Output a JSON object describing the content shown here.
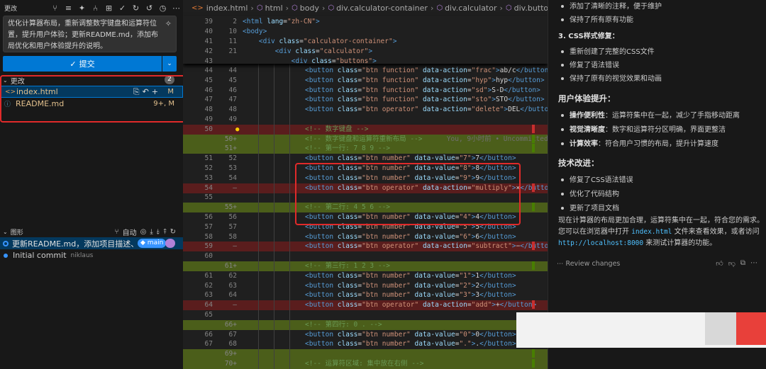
{
  "scm": {
    "title": "更改",
    "commit_message": "优化计算器布局，重新调整数字键盘和运算符位置，提升用户体验；更新README.md，添加布局优化和用户体验提升的说明。",
    "commit_label": "提交",
    "changes_label": "更改",
    "changes_count": "2",
    "files": [
      {
        "name": "index.html",
        "status": "M"
      },
      {
        "name": "README.md",
        "status": "9+, M"
      }
    ],
    "graph_label": "图形",
    "graph_auto": "自动",
    "commits": [
      {
        "message": "更新README.md，添加项目描述、功...",
        "branch": "main"
      },
      {
        "message": "Initial commit",
        "author": "niklaus"
      }
    ]
  },
  "editor": {
    "breadcrumb": [
      "index.html",
      "html",
      "body",
      "div.calculator-container",
      "div.calculator",
      "div.buttons"
    ],
    "sticky": [
      {
        "ln1": "39",
        "ln2": "2",
        "html": "<html lang=\"zh-CN\">"
      },
      {
        "ln1": "40",
        "ln2": "10",
        "html": "<body>"
      },
      {
        "ln1": "41",
        "ln2": "11",
        "html": "    <div class=\"calculator-container\">"
      },
      {
        "ln1": "42",
        "ln2": "21",
        "html": "        <div class=\"calculator\">"
      },
      {
        "ln1": "43",
        "ln2": "",
        "html": "            <div class=\"buttons\">"
      }
    ],
    "lines": [
      {
        "ln1": "44",
        "ln2": "44",
        "kind": "",
        "code": "<button class=\"btn function\" data-action=\"frac\">ab/c</button>"
      },
      {
        "ln1": "45",
        "ln2": "45",
        "kind": "",
        "code": "<button class=\"btn function\" data-action=\"hyp\">hyp</button>"
      },
      {
        "ln1": "46",
        "ln2": "46",
        "kind": "",
        "code": "<button class=\"btn function\" data-action=\"sd\">S-D</button>"
      },
      {
        "ln1": "47",
        "ln2": "47",
        "kind": "",
        "code": "<button class=\"btn function\" data-action=\"sto\">STO</button>"
      },
      {
        "ln1": "48",
        "ln2": "48",
        "kind": "",
        "code": "<button class=\"btn operator\" data-action=\"delete\">DEL</button>"
      },
      {
        "ln1": "49",
        "ln2": "49",
        "kind": "",
        "code": ""
      },
      {
        "ln1": "50",
        "ln2": "",
        "kind": "del",
        "code": "<!-- 数字键盘 -->"
      },
      {
        "ln1": "",
        "ln2": "50+",
        "kind": "add",
        "code": "<!-- 数字键盘和运算符重新布局 -->      You, 9小时前 • Uncommitted"
      },
      {
        "ln1": "",
        "ln2": "51+",
        "kind": "add",
        "code": "<!-- 第一行: 7 8 9 -->"
      },
      {
        "ln1": "51",
        "ln2": "52",
        "kind": "",
        "code": "<button class=\"btn number\" data-value=\"7\">7</button>"
      },
      {
        "ln1": "52",
        "ln2": "53",
        "kind": "",
        "code": "<button class=\"btn number\" data-value=\"8\">8</button>"
      },
      {
        "ln1": "53",
        "ln2": "54",
        "kind": "",
        "code": "<button class=\"btn number\" data-value=\"9\">9</button>"
      },
      {
        "ln1": "54",
        "ln2": "—",
        "kind": "del",
        "code": "<button class=\"btn operator\" data-action=\"multiply\">×</button>"
      },
      {
        "ln1": "55",
        "ln2": "",
        "kind": "",
        "code": ""
      },
      {
        "ln1": "",
        "ln2": "55+",
        "kind": "add",
        "code": "<!-- 第二行: 4 5 6 -->"
      },
      {
        "ln1": "56",
        "ln2": "56",
        "kind": "",
        "code": "<button class=\"btn number\" data-value=\"4\">4</button>"
      },
      {
        "ln1": "57",
        "ln2": "57",
        "kind": "",
        "code": "<button class=\"btn number\" data-value=\"5\">5</button>"
      },
      {
        "ln1": "58",
        "ln2": "58",
        "kind": "",
        "code": "<button class=\"btn number\" data-value=\"6\">6</button>"
      },
      {
        "ln1": "59",
        "ln2": "—",
        "kind": "del",
        "code": "<button class=\"btn operator\" data-action=\"subtract\">−</button>"
      },
      {
        "ln1": "60",
        "ln2": "",
        "kind": "",
        "code": ""
      },
      {
        "ln1": "",
        "ln2": "61+",
        "kind": "add",
        "code": "<!-- 第三行: 1 2 3 -->"
      },
      {
        "ln1": "61",
        "ln2": "62",
        "kind": "",
        "code": "<button class=\"btn number\" data-value=\"1\">1</button>"
      },
      {
        "ln1": "62",
        "ln2": "63",
        "kind": "",
        "code": "<button class=\"btn number\" data-value=\"2\">2</button>"
      },
      {
        "ln1": "63",
        "ln2": "64",
        "kind": "",
        "code": "<button class=\"btn number\" data-value=\"3\">3</button>"
      },
      {
        "ln1": "64",
        "ln2": "—",
        "kind": "del",
        "code": "<button class=\"btn operator\" data-action=\"add\">+</button>"
      },
      {
        "ln1": "65",
        "ln2": "",
        "kind": "",
        "code": ""
      },
      {
        "ln1": "",
        "ln2": "66+",
        "kind": "add",
        "code": "<!-- 第四行: 0 . -->"
      },
      {
        "ln1": "66",
        "ln2": "67",
        "kind": "",
        "code": "<button class=\"btn number\" data-value=\"0\">0</button>"
      },
      {
        "ln1": "67",
        "ln2": "68",
        "kind": "",
        "code": "<button class=\"btn number\" data-value=\".\">.</button>"
      },
      {
        "ln1": "",
        "ln2": "69+",
        "kind": "add",
        "code": ""
      },
      {
        "ln1": "",
        "ln2": "70+",
        "kind": "add",
        "code": "<!-- 运算符区域: 集中放在右侧 -->"
      }
    ]
  },
  "chat": {
    "top_items": [
      "添加了清晰的注释，便于维护",
      "保持了所有原有功能"
    ],
    "css_heading": "3. CSS样式修复：",
    "css_items": [
      "重新创建了完整的CSS文件",
      "修复了语法错误",
      "保持了原有的视觉效果和动画"
    ],
    "ux_heading": "用户体验提升：",
    "ux_items": [
      {
        "bold": "操作便利性",
        "text": "：运算符集中在一起，减少了手指移动距离"
      },
      {
        "bold": "视觉清晰度",
        "text": "：数字和运算符分区明确，界面更整洁"
      },
      {
        "bold": "计算效率",
        "text": "：符合用户习惯的布局，提升计算速度"
      }
    ],
    "tech_heading": "技术改进：",
    "tech_items": [
      "修复了CSS语法错误",
      "优化了代码结构",
      "更新了项目文档"
    ],
    "summary_1": "现在计算器的布局更加合理，运算符集中在一起，符合您的需求。",
    "summary_2a": "您可以在浏览器中打开 ",
    "summary_code1": "index.html",
    "summary_2b": " 文件来查看效果，或者访问",
    "summary_code2": "http://localhost:8000",
    "summary_3": " 来测试计算器的功能。",
    "review_label": "Review changes"
  }
}
